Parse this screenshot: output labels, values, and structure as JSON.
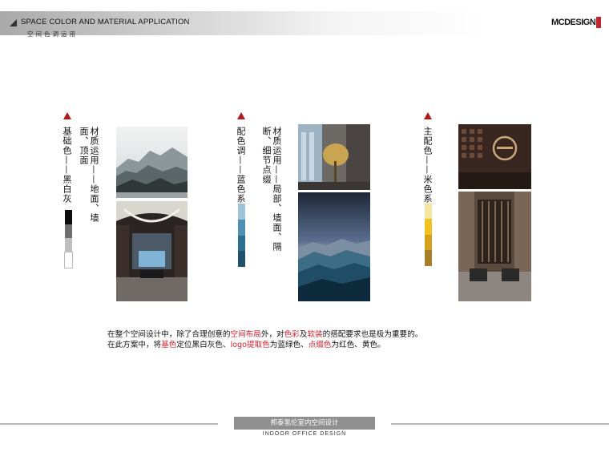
{
  "header": {
    "title": "SPACE COLOR AND MATERIAL APPLICATION",
    "subtitle": "空间色调运用",
    "logo_text": "MCDESIGN"
  },
  "groups": [
    {
      "label": "基础色——黑白灰",
      "material": "材质运用——地面、墙面、顶面",
      "swatches": [
        "#0d0d0d",
        "#6e6e6e",
        "#bfbfbf",
        "#ffffff"
      ]
    },
    {
      "label": "配色调——蓝色系",
      "material": "材质运用——局部、墙面、隔断、细节点缀",
      "swatches": [
        "#9ec4d8",
        "#4f8fb1",
        "#2d6e93",
        "#1f506c"
      ]
    },
    {
      "label": "主配色——米色系",
      "swatches": [
        "#f3e6a0",
        "#f0c322",
        "#d7a01a",
        "#a77f2a"
      ]
    }
  ],
  "description": {
    "line1_a": "在整个空间设计中，除了合理创意的",
    "line1_b": "空间布局",
    "line1_c": "外，对",
    "line1_d": "色彩",
    "line1_e": "及",
    "line1_f": "软装",
    "line1_g": "的搭配要求也是极为重要的。",
    "line2_a": "在此方案中，将",
    "line2_b": "基色",
    "line2_c": "定位黑白灰色、",
    "line2_d": "logo提取色",
    "line2_e": "为蓝绿色、",
    "line2_f": "点缀色",
    "line2_g": "为红色、黄色。"
  },
  "footer": {
    "cn": "邦泰氢伦室内空间设计",
    "en": "INDOOR OFFICE DESIGN"
  },
  "colors": {
    "accent": "#b31b1b",
    "highlight": "#d4202a"
  }
}
